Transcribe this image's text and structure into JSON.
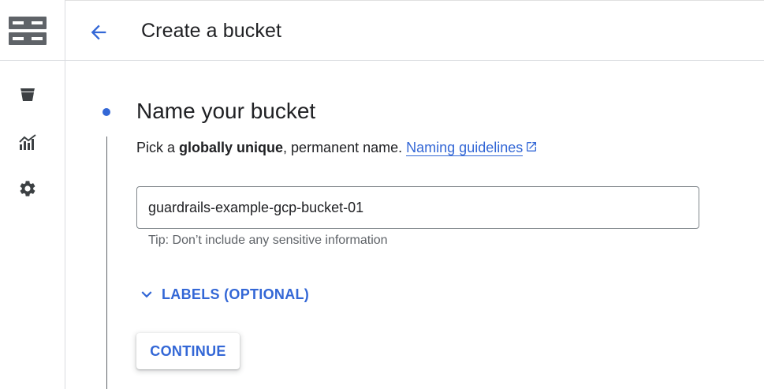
{
  "header": {
    "title": "Create a bucket",
    "back_icon": "arrow-back-icon"
  },
  "rail": {
    "logo_icon": "cloud-storage-logo-icon",
    "items": [
      {
        "icon": "bucket-icon"
      },
      {
        "icon": "monitoring-chart-icon"
      },
      {
        "icon": "settings-gear-icon"
      }
    ]
  },
  "step": {
    "title": "Name your bucket",
    "desc_prefix": "Pick a ",
    "desc_bold": "globally unique",
    "desc_suffix": ", permanent name.",
    "link_text": "Naming guidelines"
  },
  "name_input": {
    "value": "guardrails-example-gcp-bucket-01",
    "tip": "Tip: Don’t include any sensitive information"
  },
  "labels_toggle": {
    "label": "LABELS (OPTIONAL)"
  },
  "continue_button": {
    "label": "CONTINUE"
  },
  "colors": {
    "accent": "#3367d6",
    "text": "#202124",
    "muted": "#5f6368",
    "border": "#dadce0"
  }
}
